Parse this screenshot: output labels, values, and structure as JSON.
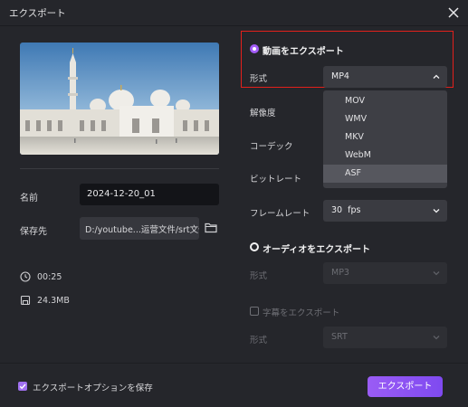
{
  "window": {
    "title": "エクスポート"
  },
  "left": {
    "name_label": "名前",
    "name_value": "2024-12-20_01",
    "save_label": "保存先",
    "save_path": "D:/youtube...运营文件/srt文件",
    "duration": "00:25",
    "size": "24.3MB"
  },
  "video_export": {
    "label": "動画をエクスポート",
    "format_label": "形式",
    "format_value": "MP4",
    "format_options": [
      "MOV",
      "WMV",
      "MKV",
      "WebM",
      "ASF"
    ],
    "resolution_label": "解像度",
    "codec_label": "コーデック",
    "bitrate_label": "ビットレート",
    "framerate_label": "フレームレート",
    "framerate_value": "30  fps"
  },
  "audio_export": {
    "label": "オーディオをエクスポート",
    "format_label": "形式",
    "format_value": "MP3"
  },
  "subtitle_export": {
    "label": "字幕をエクスポート",
    "format_label": "形式",
    "format_value": "SRT"
  },
  "footer": {
    "save_options_label": "エクスポートオプションを保存",
    "export_button": "エクスポート"
  },
  "colors": {
    "accent": "#a35cf7",
    "highlight_box": "#e3201b"
  }
}
